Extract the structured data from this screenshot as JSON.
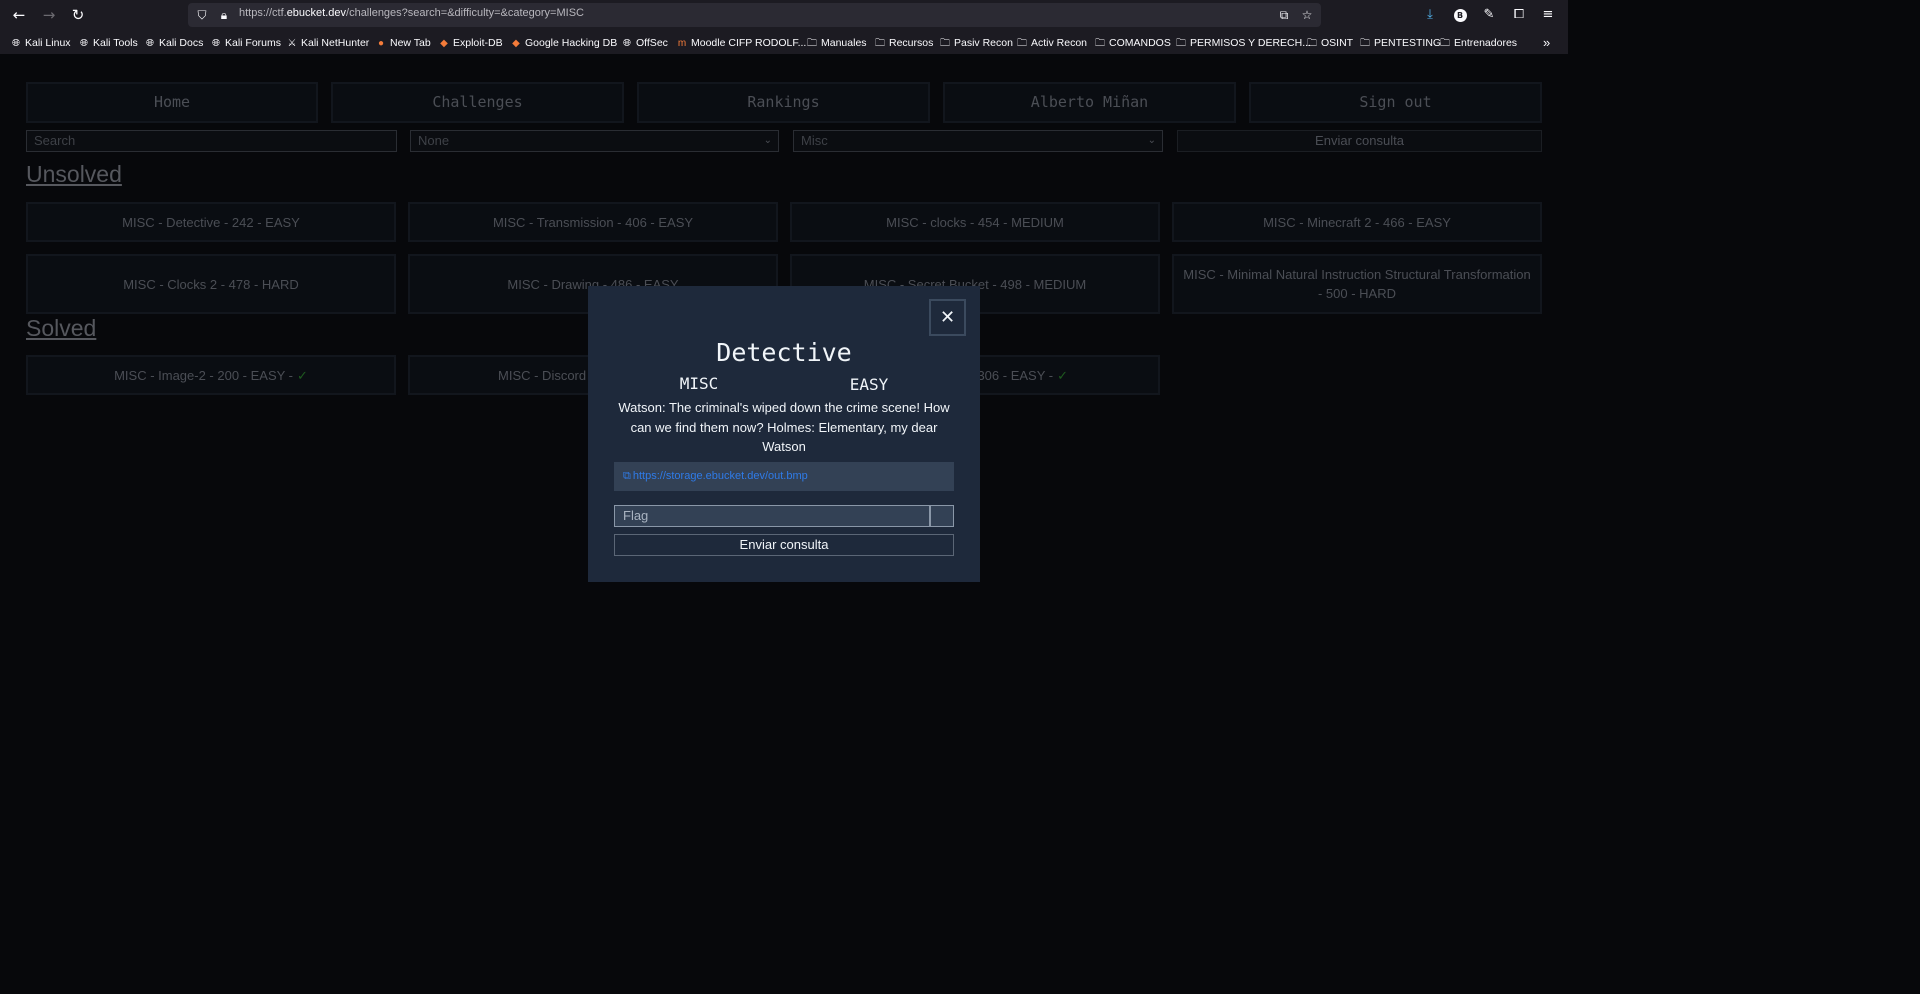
{
  "browser": {
    "url_prefix": "https://ctf.",
    "url_domain": "ebucket.dev",
    "url_path": "/challenges?search=&difficulty=&category=MISC",
    "bookmarks": [
      {
        "label": "Kali Linux",
        "icon": "globe-icon"
      },
      {
        "label": "Kali Tools",
        "icon": "globe-icon"
      },
      {
        "label": "Kali Docs",
        "icon": "globe-icon"
      },
      {
        "label": "Kali Forums",
        "icon": "globe-icon"
      },
      {
        "label": "Kali NetHunter",
        "icon": "nethunter-icon"
      },
      {
        "label": "New Tab",
        "icon": "firefox-icon"
      },
      {
        "label": "Exploit-DB",
        "icon": "exploitdb-icon"
      },
      {
        "label": "Google Hacking DB",
        "icon": "exploitdb-icon"
      },
      {
        "label": "OffSec",
        "icon": "globe-icon"
      },
      {
        "label": "Moodle CIFP RODOLF...",
        "icon": "moodle-icon"
      },
      {
        "label": "Manuales",
        "icon": "folder-icon"
      },
      {
        "label": "Recursos",
        "icon": "folder-icon"
      },
      {
        "label": "Pasiv Recon",
        "icon": "folder-icon"
      },
      {
        "label": "Activ Recon",
        "icon": "folder-icon"
      },
      {
        "label": "COMANDOS",
        "icon": "folder-icon"
      },
      {
        "label": "PERMISOS Y DERECH...",
        "icon": "folder-icon"
      },
      {
        "label": "OSINT",
        "icon": "folder-icon"
      },
      {
        "label": "PENTESTING",
        "icon": "folder-icon"
      },
      {
        "label": "Entrenadores",
        "icon": "folder-icon"
      }
    ],
    "avatar_letter": "B"
  },
  "nav": {
    "home": "Home",
    "challenges": "Challenges",
    "rankings": "Rankings",
    "user": "Alberto Miñan",
    "signout": "Sign out"
  },
  "filters": {
    "search_placeholder": "Search",
    "difficulty_selected": "None",
    "category_selected": "Misc",
    "submit": "Enviar consulta"
  },
  "unsolved": {
    "heading": "Unsolved",
    "cards": [
      "MISC - Detective - 242 - EASY",
      "MISC - Transmission - 406 - EASY",
      "MISC - clocks - 454 - MEDIUM",
      "MISC - Minecraft 2 - 466 - EASY",
      "MISC - Clocks 2 - 478 - HARD",
      "MISC - Drawing - 486 - EASY",
      "MISC - Secret Bucket - 498 - MEDIUM",
      "MISC - Minimal Natural Instruction Structural Transformation - 500 - HARD"
    ]
  },
  "solved": {
    "heading": "Solved",
    "cards": [
      "MISC - Image-2 - 200 - EASY -",
      "MISC - Discord",
      "306 - EASY -"
    ],
    "check": "✓"
  },
  "modal": {
    "title": "Detective",
    "category": "MISC",
    "difficulty": "EASY",
    "description": "Watson: The criminal's wiped down the crime scene! How can we find them now? Holmes: Elementary, my dear Watson",
    "link": "https://storage.ebucket.dev/out.bmp",
    "flag_placeholder": "Flag",
    "submit": "Enviar consulta",
    "close_glyph": "✕"
  }
}
